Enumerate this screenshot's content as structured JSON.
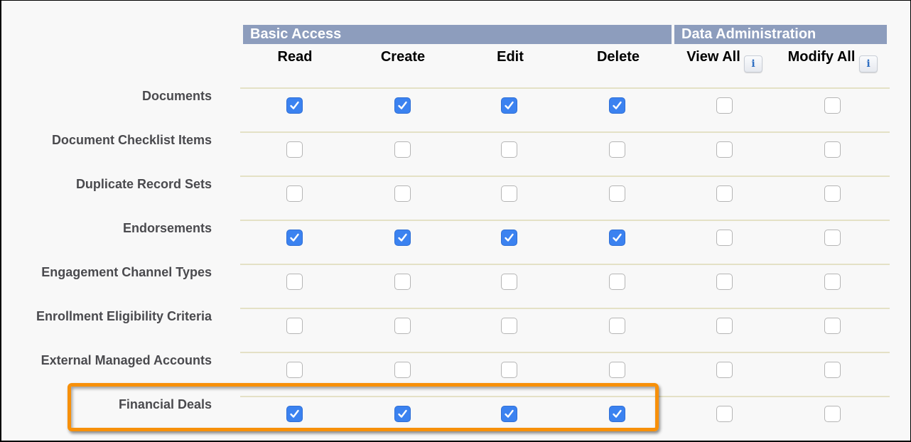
{
  "groups": {
    "basic_access": "Basic Access",
    "data_administration": "Data Administration"
  },
  "columns": [
    "Read",
    "Create",
    "Edit",
    "Delete",
    "View All",
    "Modify All"
  ],
  "info_icon": "i",
  "rows": [
    {
      "label": "Documents",
      "checks": [
        true,
        true,
        true,
        true,
        false,
        false
      ]
    },
    {
      "label": "Document Checklist Items",
      "checks": [
        false,
        false,
        false,
        false,
        false,
        false
      ]
    },
    {
      "label": "Duplicate Record Sets",
      "checks": [
        false,
        false,
        false,
        false,
        false,
        false
      ]
    },
    {
      "label": "Endorsements",
      "checks": [
        true,
        true,
        true,
        true,
        false,
        false
      ]
    },
    {
      "label": "Engagement Channel Types",
      "checks": [
        false,
        false,
        false,
        false,
        false,
        false
      ]
    },
    {
      "label": "Enrollment Eligibility Criteria",
      "checks": [
        false,
        false,
        false,
        false,
        false,
        false
      ]
    },
    {
      "label": "External Managed Accounts",
      "checks": [
        false,
        false,
        false,
        false,
        false,
        false
      ]
    },
    {
      "label": "Financial Deals",
      "checks": [
        true,
        true,
        true,
        true,
        false,
        false
      ],
      "highlighted": true
    }
  ],
  "colors": {
    "group_header_bg": "#8d9dbd",
    "checkbox_checked": "#3b82f0",
    "highlight": "#f7900a",
    "divider": "#e4e1c6"
  }
}
